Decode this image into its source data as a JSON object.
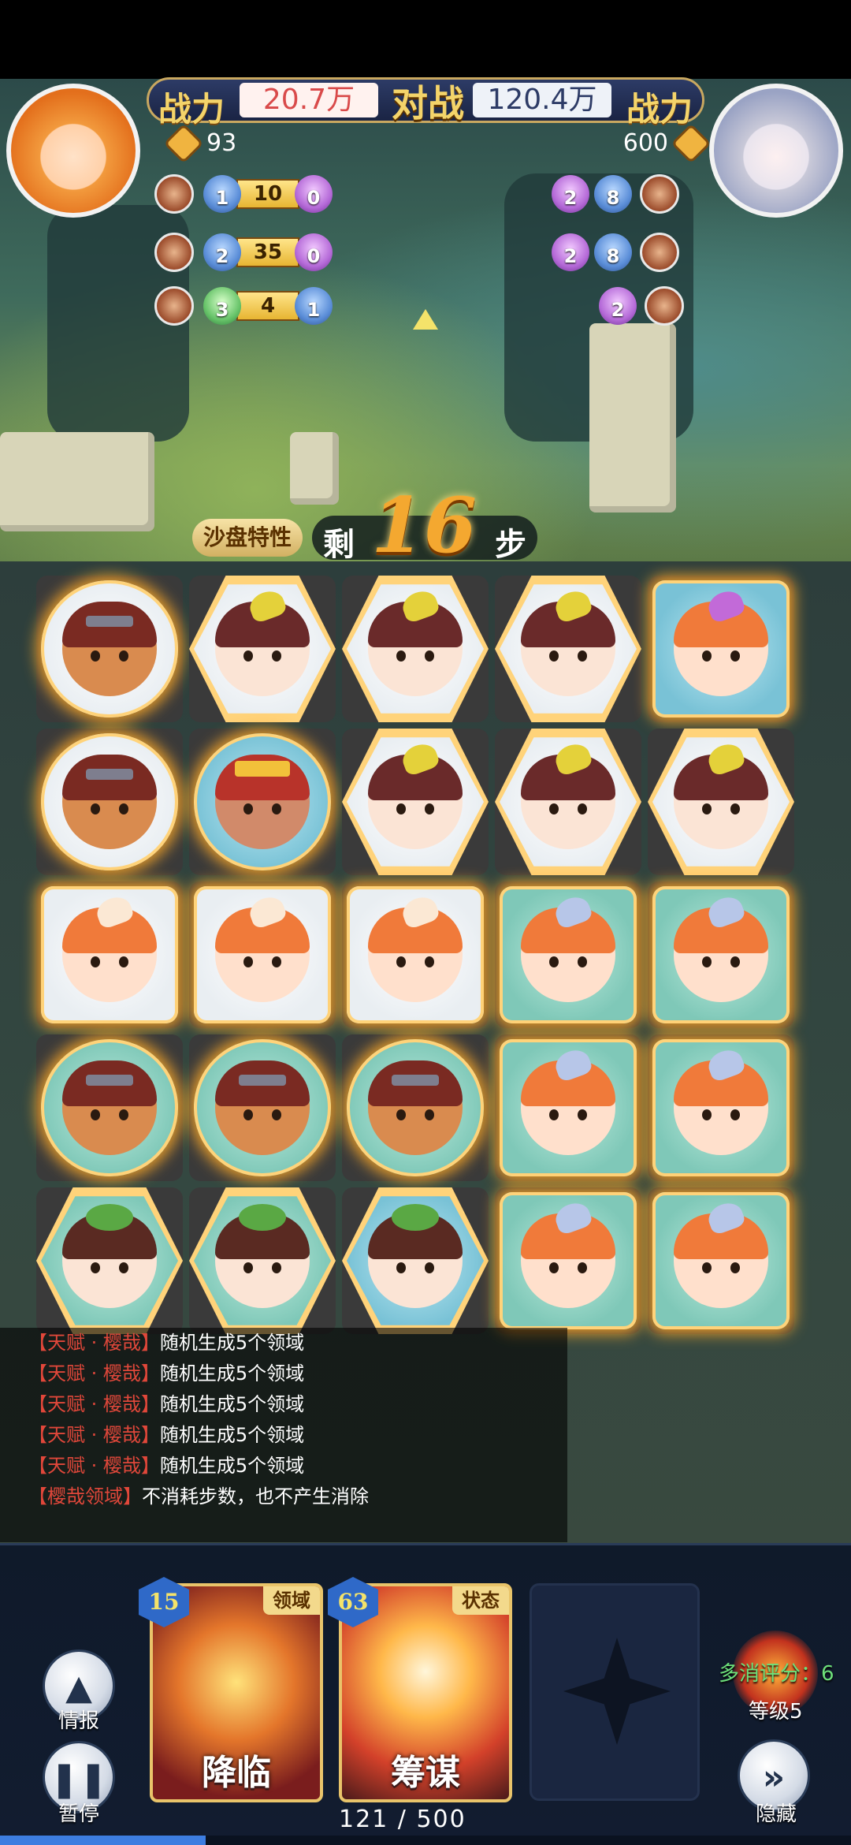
{
  "header": {
    "power_label_left": "战力",
    "power_value_left": "20.7万",
    "versus_label": "对战",
    "power_value_right": "120.4万",
    "power_label_right": "战力",
    "coins_left": "93",
    "coins_right": "600"
  },
  "left_team": [
    {
      "gem1": "1",
      "hp": "10",
      "gem2": "0"
    },
    {
      "gem1": "2",
      "hp": "35",
      "gem2": "0"
    },
    {
      "gem1": "3",
      "hp": "4",
      "gem2": "1"
    }
  ],
  "right_team": [
    {
      "gem1": "2",
      "gem2": "8"
    },
    {
      "gem1": "2",
      "gem2": "8"
    },
    {
      "gem1": "2"
    }
  ],
  "steps": {
    "sandbox_label": "沙盘特性",
    "prefix": "剩",
    "count": "16",
    "suffix": "步"
  },
  "board": {
    "rows": [
      [
        {
          "face": "bear",
          "shape": "circle",
          "bg": "white"
        },
        {
          "face": "girl",
          "shape": "hex",
          "bg": "white"
        },
        {
          "face": "girl",
          "shape": "hex",
          "bg": "white"
        },
        {
          "face": "girl",
          "shape": "hex",
          "bg": "white"
        },
        {
          "face": "orange-purple",
          "shape": "square",
          "bg": "sky"
        }
      ],
      [
        {
          "face": "bear",
          "shape": "circle",
          "bg": "white"
        },
        {
          "face": "boss",
          "shape": "circle",
          "bg": "sky"
        },
        {
          "face": "girl",
          "shape": "hex",
          "bg": "white"
        },
        {
          "face": "girl",
          "shape": "hex",
          "bg": "white"
        },
        {
          "face": "girl",
          "shape": "hex",
          "bg": "white"
        }
      ],
      [
        {
          "face": "orange-cream",
          "shape": "square",
          "bg": "white"
        },
        {
          "face": "orange-cream",
          "shape": "square",
          "bg": "white"
        },
        {
          "face": "orange-cream",
          "shape": "square",
          "bg": "white"
        },
        {
          "face": "orange",
          "shape": "square",
          "bg": "teal"
        },
        {
          "face": "orange",
          "shape": "square",
          "bg": "teal"
        }
      ],
      [
        {
          "face": "bear",
          "shape": "circle",
          "bg": "teal"
        },
        {
          "face": "bear",
          "shape": "circle",
          "bg": "teal"
        },
        {
          "face": "bear",
          "shape": "circle",
          "bg": "teal"
        },
        {
          "face": "orange",
          "shape": "square",
          "bg": "teal"
        },
        {
          "face": "orange",
          "shape": "square",
          "bg": "teal"
        }
      ],
      [
        {
          "face": "leaf",
          "shape": "hex",
          "bg": "teal"
        },
        {
          "face": "leaf",
          "shape": "hex",
          "bg": "teal"
        },
        {
          "face": "leaf",
          "shape": "hex",
          "bg": "sky"
        },
        {
          "face": "orange",
          "shape": "square",
          "bg": "teal"
        },
        {
          "face": "orange",
          "shape": "square",
          "bg": "teal"
        }
      ]
    ]
  },
  "log": [
    {
      "tag": "【天赋 · 樱哉】",
      "text": "随机生成5个领域"
    },
    {
      "tag": "【天赋 · 樱哉】",
      "text": "随机生成5个领域"
    },
    {
      "tag": "【天赋 · 樱哉】",
      "text": "随机生成5个领域"
    },
    {
      "tag": "【天赋 · 樱哉】",
      "text": "随机生成5个领域"
    },
    {
      "tag": "【天赋 · 樱哉】",
      "text": "随机生成5个领域"
    },
    {
      "tag": "【樱哉领域】",
      "text": "不消耗步数，也不产生消除"
    }
  ],
  "controls": {
    "intel_label": "情报",
    "pause_label": "暂停",
    "hide_label": "隐藏"
  },
  "cards": [
    {
      "cost": "15",
      "tag": "领域",
      "name": "降临"
    },
    {
      "cost": "63",
      "tag": "状态",
      "name": "筹谋"
    }
  ],
  "combo": {
    "score_text": "多消评分：6",
    "level_text": "等级5"
  },
  "progress": {
    "text": "121 / 500",
    "fraction": 0.242
  },
  "colors": {
    "glow": "#ffaa28",
    "log_tag": "#e0473a",
    "steps_number": "#f4a830",
    "combo_score": "#6de07a"
  }
}
